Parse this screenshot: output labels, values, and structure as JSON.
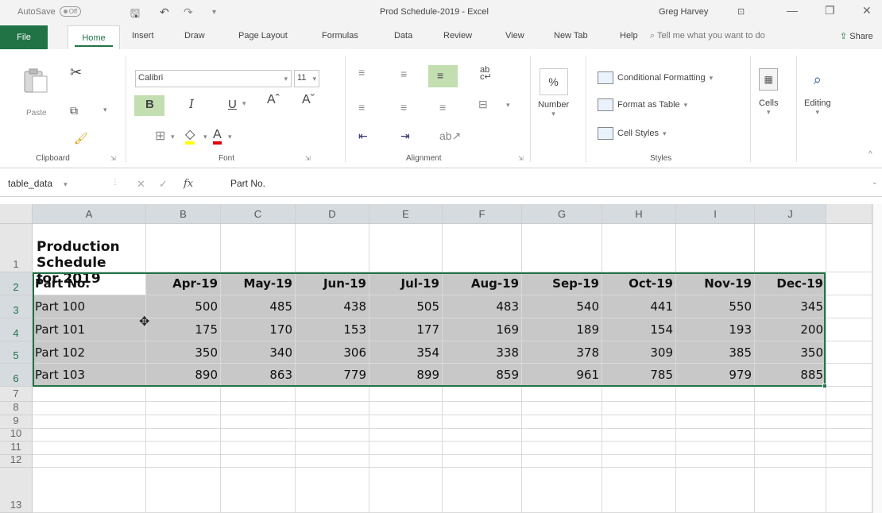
{
  "titlebar": {
    "autosave_label": "AutoSave",
    "autosave_state": "Off",
    "doc_title": "Prod Schedule-2019  -  Excel",
    "user_name": "Greg Harvey"
  },
  "tabs": [
    "File",
    "Home",
    "Insert",
    "Draw",
    "Page Layout",
    "Formulas",
    "Data",
    "Review",
    "View",
    "New Tab",
    "Help"
  ],
  "tell_me": "Tell me what you want to do",
  "share": "Share",
  "ribbon": {
    "clipboard": {
      "label": "Clipboard",
      "paste": "Paste"
    },
    "font": {
      "label": "Font",
      "family": "Calibri",
      "size": "11",
      "bold": "B",
      "italic": "I",
      "underline": "U"
    },
    "alignment": {
      "label": "Alignment"
    },
    "number": {
      "label": "Number",
      "symbol": "%"
    },
    "styles": {
      "label": "Styles",
      "conditional": "Conditional Formatting",
      "format_table": "Format as Table",
      "cell_styles": "Cell Styles"
    },
    "cells": {
      "label": "Cells"
    },
    "editing": {
      "label": "Editing"
    }
  },
  "formula_bar": {
    "name_box": "table_data",
    "fx": "fx",
    "value": "Part No."
  },
  "columns": [
    "A",
    "B",
    "C",
    "D",
    "E",
    "F",
    "G",
    "H",
    "I",
    "J"
  ],
  "rows": [
    "1",
    "2",
    "3",
    "4",
    "5",
    "6",
    "7",
    "8",
    "9",
    "10",
    "11",
    "12",
    "13"
  ],
  "sheet": {
    "title": "Production Schedule for 2019",
    "headers": [
      "Part No.",
      "Apr-19",
      "May-19",
      "Jun-19",
      "Jul-19",
      "Aug-19",
      "Sep-19",
      "Oct-19",
      "Nov-19",
      "Dec-19"
    ],
    "data": [
      [
        "Part 100",
        "500",
        "485",
        "438",
        "505",
        "483",
        "540",
        "441",
        "550",
        "345"
      ],
      [
        "Part 101",
        "175",
        "170",
        "153",
        "177",
        "169",
        "189",
        "154",
        "193",
        "200"
      ],
      [
        "Part 102",
        "350",
        "340",
        "306",
        "354",
        "338",
        "378",
        "309",
        "385",
        "350"
      ],
      [
        "Part 103",
        "890",
        "863",
        "779",
        "899",
        "859",
        "961",
        "785",
        "979",
        "885"
      ]
    ]
  },
  "colors": {
    "excel_green": "#217346",
    "selection_fill": "#c8c8c8"
  }
}
